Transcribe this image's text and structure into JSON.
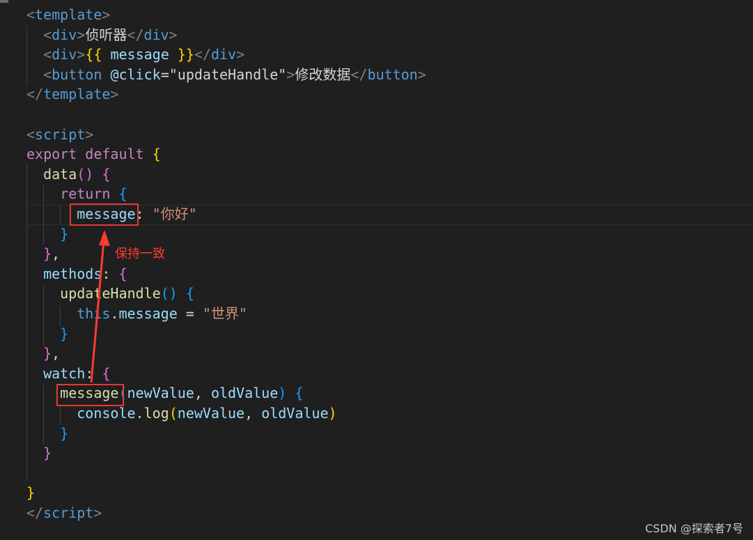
{
  "code": {
    "lines": [
      [
        {
          "t": "<",
          "c": "punct-tag"
        },
        {
          "t": "template",
          "c": "tag"
        },
        {
          "t": ">",
          "c": "punct-tag"
        }
      ],
      [
        {
          "t": "  "
        },
        {
          "t": "<",
          "c": "punct-tag"
        },
        {
          "t": "div",
          "c": "tag"
        },
        {
          "t": ">",
          "c": "punct-tag"
        },
        {
          "t": "侦听器",
          "c": "text"
        },
        {
          "t": "</",
          "c": "punct-tag"
        },
        {
          "t": "div",
          "c": "tag"
        },
        {
          "t": ">",
          "c": "punct-tag"
        }
      ],
      [
        {
          "t": "  "
        },
        {
          "t": "<",
          "c": "punct-tag"
        },
        {
          "t": "div",
          "c": "tag"
        },
        {
          "t": ">",
          "c": "punct-tag"
        },
        {
          "t": "{{",
          "c": "b1"
        },
        {
          "t": " message ",
          "c": "prop"
        },
        {
          "t": "}}",
          "c": "b1"
        },
        {
          "t": "</",
          "c": "punct-tag"
        },
        {
          "t": "div",
          "c": "tag"
        },
        {
          "t": ">",
          "c": "punct-tag"
        }
      ],
      [
        {
          "t": "  "
        },
        {
          "t": "<",
          "c": "punct-tag"
        },
        {
          "t": "button",
          "c": "tag"
        },
        {
          "t": " "
        },
        {
          "t": "@click",
          "c": "attr"
        },
        {
          "t": "=",
          "c": "plain"
        },
        {
          "t": "\"updateHandle\"",
          "c": "plain"
        },
        {
          "t": ">",
          "c": "punct-tag"
        },
        {
          "t": "修改数据",
          "c": "text"
        },
        {
          "t": "</",
          "c": "punct-tag"
        },
        {
          "t": "button",
          "c": "tag"
        },
        {
          "t": ">",
          "c": "punct-tag"
        }
      ],
      [
        {
          "t": "</",
          "c": "punct-tag"
        },
        {
          "t": "template",
          "c": "tag"
        },
        {
          "t": ">",
          "c": "punct-tag"
        }
      ],
      [],
      [
        {
          "t": "<",
          "c": "punct-tag"
        },
        {
          "t": "script",
          "c": "tag"
        },
        {
          "t": ">",
          "c": "punct-tag"
        }
      ],
      [
        {
          "t": "export",
          "c": "kw"
        },
        {
          "t": " "
        },
        {
          "t": "default",
          "c": "kw"
        },
        {
          "t": " "
        },
        {
          "t": "{",
          "c": "b1"
        }
      ],
      [
        {
          "t": "  "
        },
        {
          "t": "data",
          "c": "fn"
        },
        {
          "t": "()",
          "c": "b2"
        },
        {
          "t": " "
        },
        {
          "t": "{",
          "c": "b2"
        }
      ],
      [
        {
          "t": "    "
        },
        {
          "t": "return",
          "c": "kw"
        },
        {
          "t": " "
        },
        {
          "t": "{",
          "c": "b3"
        }
      ],
      [
        {
          "t": "      "
        },
        {
          "t": "message",
          "c": "prop"
        },
        {
          "t": ": ",
          "c": "plain"
        },
        {
          "t": "\"你好\"",
          "c": "str"
        }
      ],
      [
        {
          "t": "    "
        },
        {
          "t": "}",
          "c": "b3"
        }
      ],
      [
        {
          "t": "  "
        },
        {
          "t": "}",
          "c": "b2"
        },
        {
          "t": ",",
          "c": "plain"
        }
      ],
      [
        {
          "t": "  "
        },
        {
          "t": "methods",
          "c": "prop"
        },
        {
          "t": ": ",
          "c": "plain"
        },
        {
          "t": "{",
          "c": "b2"
        }
      ],
      [
        {
          "t": "    "
        },
        {
          "t": "updateHandle",
          "c": "fn"
        },
        {
          "t": "()",
          "c": "b3"
        },
        {
          "t": " "
        },
        {
          "t": "{",
          "c": "b3"
        }
      ],
      [
        {
          "t": "      "
        },
        {
          "t": "this",
          "c": "kw2"
        },
        {
          "t": ".",
          "c": "plain"
        },
        {
          "t": "message",
          "c": "prop"
        },
        {
          "t": " = ",
          "c": "plain"
        },
        {
          "t": "\"世界\"",
          "c": "str"
        }
      ],
      [
        {
          "t": "    "
        },
        {
          "t": "}",
          "c": "b3"
        }
      ],
      [
        {
          "t": "  "
        },
        {
          "t": "}",
          "c": "b2"
        },
        {
          "t": ",",
          "c": "plain"
        }
      ],
      [
        {
          "t": "  "
        },
        {
          "t": "watch",
          "c": "prop"
        },
        {
          "t": ": ",
          "c": "plain"
        },
        {
          "t": "{",
          "c": "b2"
        }
      ],
      [
        {
          "t": "    "
        },
        {
          "t": "message",
          "c": "fn"
        },
        {
          "t": "(",
          "c": "b3"
        },
        {
          "t": "newValue",
          "c": "prop"
        },
        {
          "t": ", ",
          "c": "plain"
        },
        {
          "t": "oldValue",
          "c": "prop"
        },
        {
          "t": ")",
          "c": "b3"
        },
        {
          "t": " "
        },
        {
          "t": "{",
          "c": "b3"
        }
      ],
      [
        {
          "t": "      "
        },
        {
          "t": "console",
          "c": "prop"
        },
        {
          "t": ".",
          "c": "plain"
        },
        {
          "t": "log",
          "c": "fn"
        },
        {
          "t": "(",
          "c": "b1"
        },
        {
          "t": "newValue",
          "c": "prop"
        },
        {
          "t": ", ",
          "c": "plain"
        },
        {
          "t": "oldValue",
          "c": "prop"
        },
        {
          "t": ")",
          "c": "b1"
        }
      ],
      [
        {
          "t": "    "
        },
        {
          "t": "}",
          "c": "b3"
        }
      ],
      [
        {
          "t": "  "
        },
        {
          "t": "}",
          "c": "b2"
        }
      ],
      [],
      [
        {
          "t": "}",
          "c": "b1"
        }
      ],
      [
        {
          "t": "</",
          "c": "punct-tag"
        },
        {
          "t": "script",
          "c": "tag"
        },
        {
          "t": ">",
          "c": "punct-tag"
        }
      ]
    ]
  },
  "annotation": {
    "label": "保持一致",
    "color": "#ff3b30"
  },
  "watermark": "CSDN @探索者7号",
  "colors": {
    "background": "#1f1f1f",
    "tag": "#569cd6",
    "keyword": "#c586c0",
    "function": "#dcdcaa",
    "property": "#9cdcfe",
    "string": "#ce9178",
    "bracket_gold": "#ffd700",
    "bracket_purple": "#da70d6",
    "bracket_blue": "#179fff",
    "highlight_box": "#e53935"
  }
}
